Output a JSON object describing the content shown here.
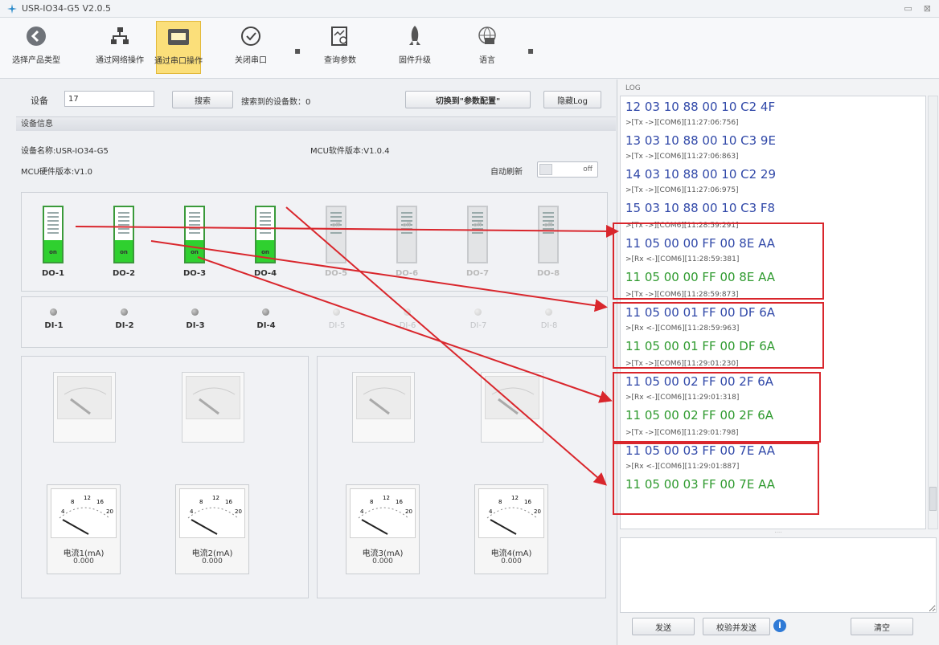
{
  "window": {
    "title": "USR-IO34-G5 V2.0.5",
    "minimize": "▭",
    "close": "⊠"
  },
  "toolbar": {
    "select_product": "选择产品类型",
    "via_network": "通过网络操作",
    "via_serial": "通过串口操作",
    "close_port": "关闭串口",
    "query_params": "查询参数",
    "firmware_upgrade": "固件升级",
    "language": "语言",
    "dropdown_glyph": "▪"
  },
  "search": {
    "device_label": "设备",
    "device_value": "17",
    "search_button": "搜索",
    "found_label": "搜索到的设备数：0",
    "switch_button": "切换到\"参数配置\"",
    "hide_log_button": "隐藏Log"
  },
  "device_info": {
    "section_title": "设备信息",
    "device_name": "设备名称:USR-IO34-G5",
    "mcu_software": "MCU软件版本:V1.0.4",
    "mcu_hardware": "MCU硬件版本:V1.0",
    "auto_refresh_label": "自动刷新",
    "auto_refresh_state": "off"
  },
  "digital_outputs": [
    {
      "label": "DO-1",
      "state": "on"
    },
    {
      "label": "DO-2",
      "state": "on"
    },
    {
      "label": "DO-3",
      "state": "on"
    },
    {
      "label": "DO-4",
      "state": "on"
    },
    {
      "label": "DO-5",
      "state": "off"
    },
    {
      "label": "DO-6",
      "state": "off"
    },
    {
      "label": "DO-7",
      "state": "off"
    },
    {
      "label": "DO-8",
      "state": "off"
    }
  ],
  "digital_inputs": [
    {
      "label": "DI-1",
      "active": true
    },
    {
      "label": "DI-2",
      "active": true
    },
    {
      "label": "DI-3",
      "active": true
    },
    {
      "label": "DI-4",
      "active": true
    },
    {
      "label": "DI-5",
      "active": false
    },
    {
      "label": "DI-6",
      "active": false
    },
    {
      "label": "DI-7",
      "active": false
    },
    {
      "label": "DI-8",
      "active": false
    }
  ],
  "meters": [
    {
      "label": "电流1(mA)",
      "value": "0.000"
    },
    {
      "label": "电流2(mA)",
      "value": "0.000"
    },
    {
      "label": "电流3(mA)",
      "value": "0.000"
    },
    {
      "label": "电流4(mA)",
      "value": "0.000"
    }
  ],
  "meter_scale": [
    "4",
    "8",
    "12",
    "16",
    "20"
  ],
  "log": {
    "title": "LOG",
    "lines": [
      {
        "kind": "tx",
        "text": "12 03 10 88 00 10 C2 4F"
      },
      {
        "kind": "tag",
        "text": ">[Tx ->][COM6][11:27:06:756]"
      },
      {
        "kind": "tx",
        "text": "13 03 10 88 00 10 C3 9E"
      },
      {
        "kind": "tag",
        "text": ">[Tx ->][COM6][11:27:06:863]"
      },
      {
        "kind": "tx",
        "text": "14 03 10 88 00 10 C2 29"
      },
      {
        "kind": "tag",
        "text": ">[Tx ->][COM6][11:27:06:975]"
      },
      {
        "kind": "tx",
        "text": "15 03 10 88 00 10 C3 F8"
      },
      {
        "kind": "tag",
        "text": ">[Tx ->][COM6][11:28:59:291]"
      },
      {
        "kind": "tx",
        "text": "11 05 00 00 FF 00 8E AA"
      },
      {
        "kind": "tag",
        "text": ">[Rx <-][COM6][11:28:59:381]"
      },
      {
        "kind": "rx",
        "text": "11 05 00 00 FF 00 8E AA"
      },
      {
        "kind": "tag",
        "text": ">[Tx ->][COM6][11:28:59:873]"
      },
      {
        "kind": "tx",
        "text": "11 05 00 01 FF 00 DF 6A"
      },
      {
        "kind": "tag",
        "text": ">[Rx <-][COM6][11:28:59:963]"
      },
      {
        "kind": "rx",
        "text": "11 05 00 01 FF 00 DF 6A"
      },
      {
        "kind": "tag",
        "text": ">[Tx ->][COM6][11:29:01:230]"
      },
      {
        "kind": "tx",
        "text": "11 05 00 02 FF 00 2F 6A"
      },
      {
        "kind": "tag",
        "text": ">[Rx <-][COM6][11:29:01:318]"
      },
      {
        "kind": "rx",
        "text": "11 05 00 02 FF 00 2F 6A"
      },
      {
        "kind": "tag",
        "text": ">[Tx ->][COM6][11:29:01:798]"
      },
      {
        "kind": "tx",
        "text": "11 05 00 03 FF 00 7E AA"
      },
      {
        "kind": "tag",
        "text": ">[Rx <-][COM6][11:29:01:887]"
      },
      {
        "kind": "rx",
        "text": "11 05 00 03 FF 00 7E AA"
      }
    ],
    "splitter": "····",
    "send_button": "发送",
    "checksum_send_button": "校验并发送",
    "info_glyph": "i",
    "clear_button": "清空"
  },
  "colors": {
    "accent_active": "#fbdf7a",
    "do_on": "#2fd02f",
    "tx_text": "#3048a8",
    "rx_text": "#2e9a2e",
    "annotation": "#d9262c"
  }
}
